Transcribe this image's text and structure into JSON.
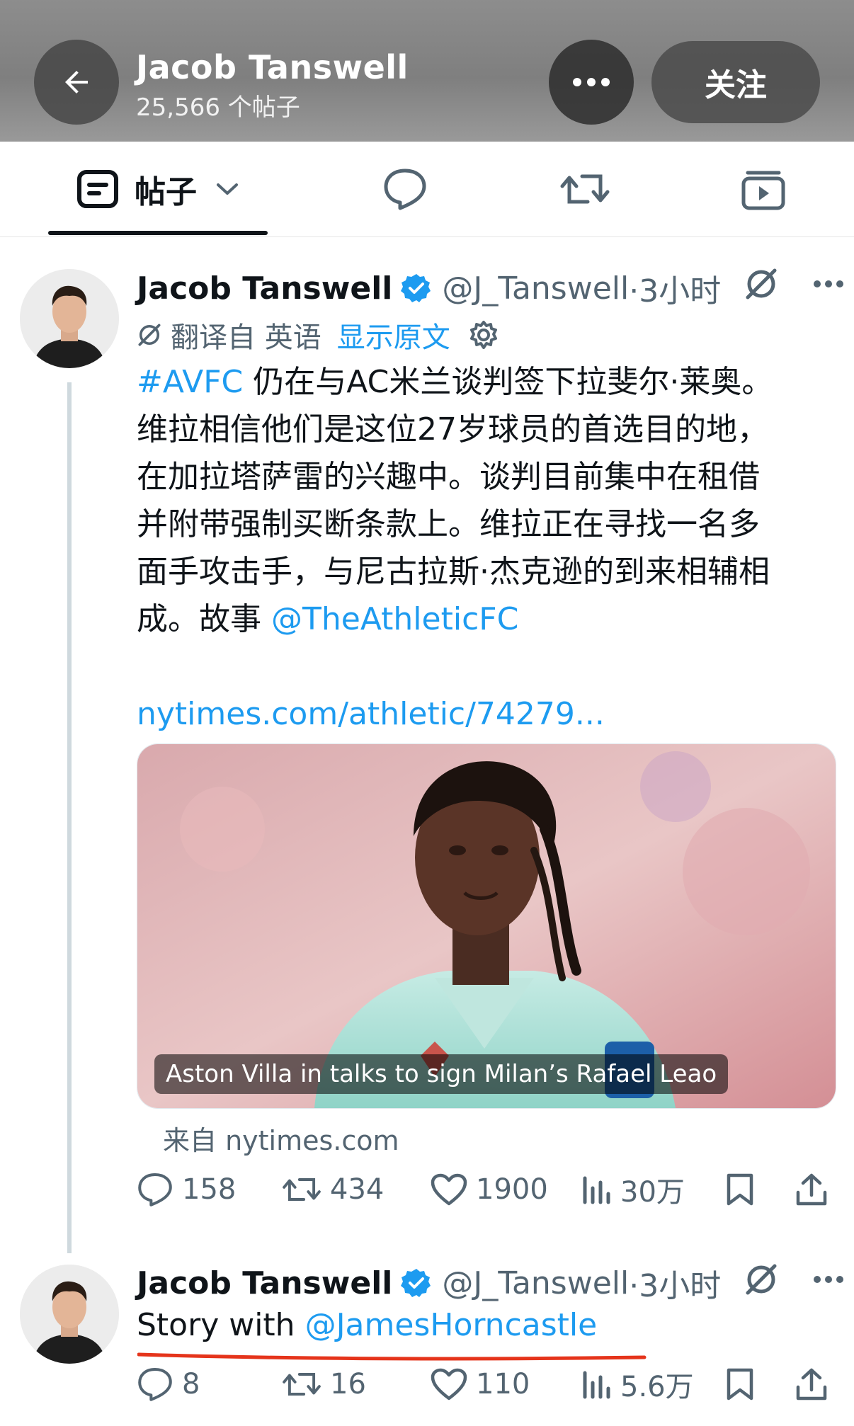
{
  "header": {
    "name": "Jacob Tanswell",
    "post_count": "25,566 个帖子",
    "follow_label": "关注"
  },
  "tabs": [
    {
      "label": "帖子",
      "icon": "posts-icon"
    },
    {
      "label": "",
      "icon": "reply-icon"
    },
    {
      "label": "",
      "icon": "repost-icon"
    },
    {
      "label": "",
      "icon": "media-icon"
    }
  ],
  "colors": {
    "accent": "#1d9bf0",
    "text": "#0f1419",
    "muted": "#536471",
    "annotation": "#e5341b"
  },
  "tweets": [
    {
      "name": "Jacob Tanswell",
      "handle": "@J_Tanswell",
      "time": "·3小时",
      "translation": {
        "label": "翻译自 英语",
        "show_original": "显示原文"
      },
      "body_lines": [
        {
          "hashtag": "#AVFC",
          "text": " 仍在与AC米兰谈判签下拉斐尔·莱奥。"
        },
        {
          "text": "维拉相信他们是这位27岁球员的首选目的地，"
        },
        {
          "text": "在加拉塔萨雷的兴趣中。谈判目前集中在租借"
        },
        {
          "text": "并附带强制买断条款上。维拉正在寻找一名多"
        },
        {
          "text": "面手攻击手，与尼古拉斯·杰克逊的到来相辅相"
        },
        {
          "text": "成。故事 ",
          "mention": "@TheAthleticFC"
        }
      ],
      "link": "nytimes.com/athletic/74279...",
      "card": {
        "caption": "Aston Villa in talks to sign Milan’s Rafael Leao",
        "source": "来自 nytimes.com"
      },
      "stats": {
        "replies": "158",
        "reposts": "434",
        "likes": "1900",
        "views": "30万"
      }
    },
    {
      "name": "Jacob Tanswell",
      "handle": "@J_Tanswell",
      "time": "·3小时",
      "body_prefix": "Story with ",
      "mention": "@JamesHorncastle",
      "stats": {
        "replies": "8",
        "reposts": "16",
        "likes": "110",
        "views": "5.6万"
      }
    }
  ]
}
